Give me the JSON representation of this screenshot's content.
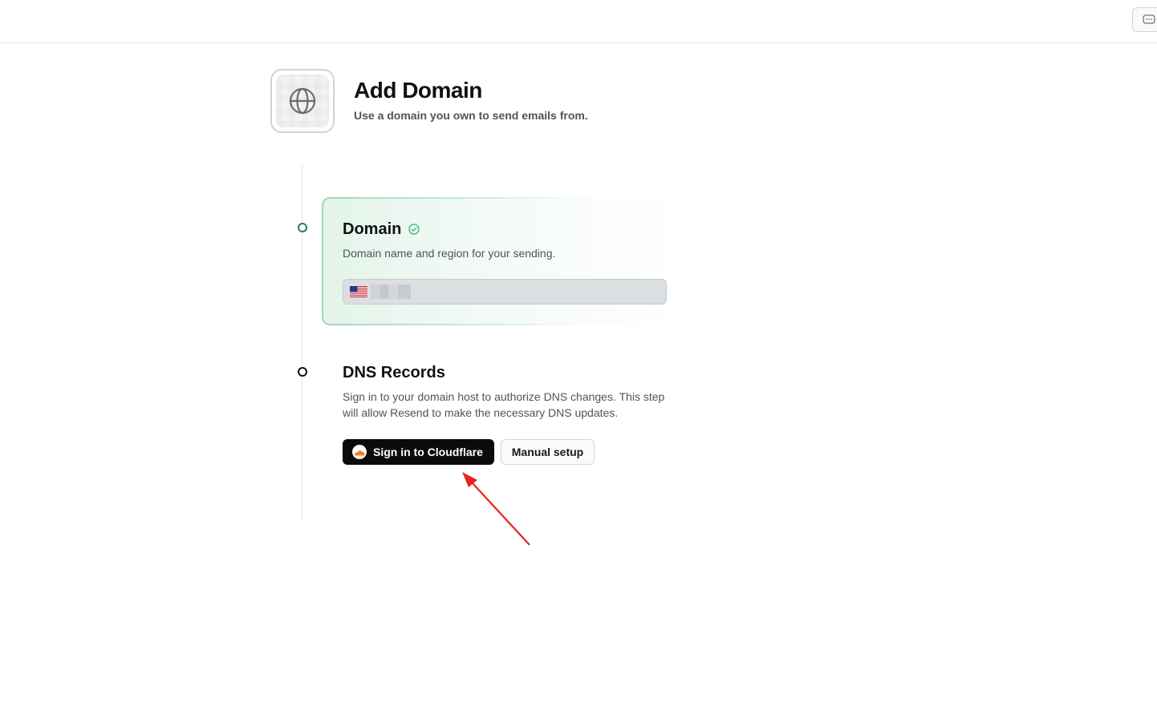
{
  "header": {
    "title": "Add Domain",
    "subtitle": "Use a domain you own to send emails from.",
    "icon": "globe-icon"
  },
  "topbar": {
    "feedback_icon": "chat-bubble-icon"
  },
  "steps": {
    "domain": {
      "title": "Domain",
      "description": "Domain name and region for your sending.",
      "status": "complete",
      "status_icon": "check-circle-icon",
      "region_flag": "us-flag-icon",
      "field_value": ""
    },
    "dns": {
      "title": "DNS Records",
      "description": "Sign in to your domain host to authorize DNS changes. This step will allow Resend to make the necessary DNS updates.",
      "primary_button": "Sign in to Cloudflare",
      "primary_icon": "cloudflare-icon",
      "secondary_button": "Manual setup"
    }
  },
  "colors": {
    "accent_green": "#2f7a54",
    "card_border_green": "#9ed9b6",
    "button_dark": "#0b0b0c",
    "cloudflare_orange": "#f38020",
    "annotation_red": "#e8231f"
  }
}
